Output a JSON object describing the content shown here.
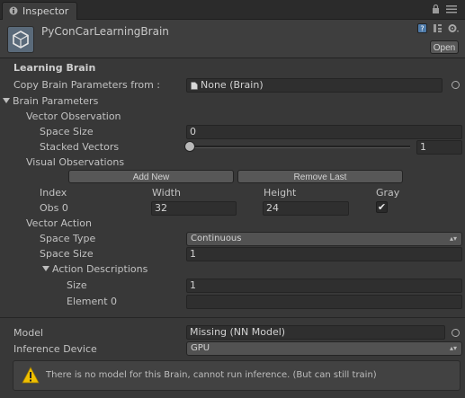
{
  "tab": {
    "title": "Inspector"
  },
  "header": {
    "object_name": "PyConCarLearningBrain",
    "open_label": "Open"
  },
  "learning_brain": {
    "title": "Learning Brain",
    "copy_label": "Copy Brain Parameters from :",
    "copy_value": "None (Brain)"
  },
  "brain_parameters": {
    "title": "Brain Parameters",
    "vector_observation": {
      "title": "Vector Observation",
      "space_size_label": "Space Size",
      "space_size_value": "0",
      "stacked_label": "Stacked Vectors",
      "stacked_value": "1",
      "stacked_slider_fraction": 0
    },
    "visual_observations": {
      "title": "Visual Observations",
      "add_new_label": "Add New",
      "remove_last_label": "Remove Last",
      "columns": [
        "Index",
        "Width",
        "Height",
        "Gray"
      ],
      "rows": [
        {
          "index": "Obs 0",
          "width": "32",
          "height": "24",
          "gray": "✔"
        }
      ]
    },
    "vector_action": {
      "title": "Vector Action",
      "space_type_label": "Space Type",
      "space_type_value": "Continuous",
      "space_size_label": "Space Size",
      "space_size_value": "1",
      "action_descriptions": {
        "title": "Action Descriptions",
        "size_label": "Size",
        "size_value": "1",
        "element0_label": "Element 0",
        "element0_value": ""
      }
    }
  },
  "model": {
    "label": "Model",
    "value": "Missing (NN Model)"
  },
  "inference": {
    "label": "Inference Device",
    "value": "GPU"
  },
  "help_box": {
    "message": "There is no model for this Brain, cannot run inference. (But can still train)"
  }
}
